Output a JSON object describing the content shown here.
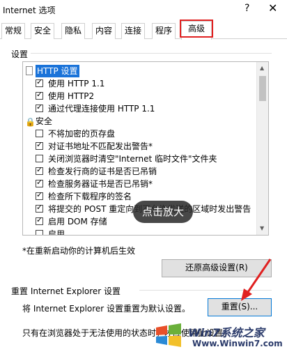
{
  "window": {
    "title": "Internet 选项",
    "help": "?",
    "close": "✕"
  },
  "tabs": [
    "常规",
    "安全",
    "隐私",
    "内容",
    "连接",
    "程序",
    "高级"
  ],
  "settings_group": "设置",
  "list": [
    {
      "type": "header",
      "label": "HTTP 设置",
      "selected": true,
      "icon": "page-icon"
    },
    {
      "type": "check",
      "label": "使用 HTTP 1.1",
      "checked": true
    },
    {
      "type": "check",
      "label": "使用 HTTP2",
      "checked": true
    },
    {
      "type": "check",
      "label": "通过代理连接使用 HTTP 1.1",
      "checked": true
    },
    {
      "type": "header",
      "label": "安全",
      "selected": false,
      "icon": "lock-icon"
    },
    {
      "type": "check",
      "label": "不将加密的页存盘",
      "checked": false
    },
    {
      "type": "check",
      "label": "对证书地址不匹配发出警告*",
      "checked": true
    },
    {
      "type": "check",
      "label": "关闭浏览器时清空\"Internet 临时文件\"文件夹",
      "checked": false
    },
    {
      "type": "check",
      "label": "检查发行商的证书是否已吊销",
      "checked": true
    },
    {
      "type": "check",
      "label": "检查服务器证书是否已吊销*",
      "checked": true
    },
    {
      "type": "check",
      "label": "检查所下载程序的签名",
      "checked": true
    },
    {
      "type": "check",
      "label": "将提交的 POST 重定向到不允许发送的区域时发出警告",
      "checked": true
    },
    {
      "type": "check",
      "label": "启用 DOM 存储",
      "checked": true
    },
    {
      "type": "check",
      "label": "启用 ...",
      "checked": false
    }
  ],
  "restart_note": "*在重新启动你的计算机后生效",
  "restore_button": "还原高级设置(R)",
  "reset_group": "重置 Internet Explorer 设置",
  "reset_desc": "将 Internet Explorer 设置重置为默认设置。",
  "reset_button": "重置(S)...",
  "footer_note": "只有在浏览器处于无法使用的状态时，才应使用此设置。",
  "overlay_label": "点击放大",
  "watermark": {
    "title": "Win7系统之家",
    "url": "Www.Winwin7.com"
  },
  "colors": {
    "selection": "#1a73d9",
    "tab_highlight": "#e02020",
    "arrow": "#e02020"
  }
}
